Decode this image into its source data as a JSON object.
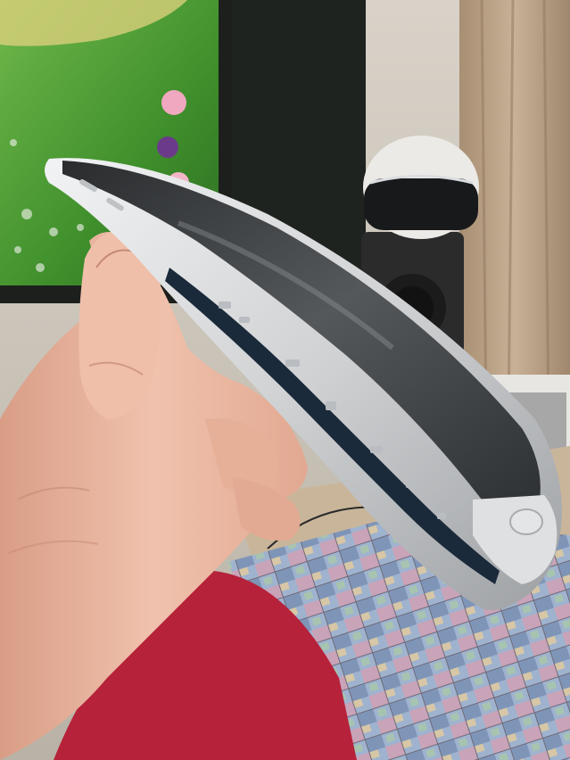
{
  "image": {
    "type": "photograph",
    "colors": {
      "tv_screen": "#4f9a33",
      "tv_bezel": "#1c1f1c",
      "wall": "#cfc7bb",
      "curtain": "#b89f84",
      "speaker": "#2b2b2c",
      "headset": "#eceae6",
      "chair": "#b6223a",
      "phone_frame": "#d9dadb",
      "phone_screen": "#3a3d40",
      "skin": "#eab7a2",
      "rug": "#8fa7c6"
    }
  }
}
